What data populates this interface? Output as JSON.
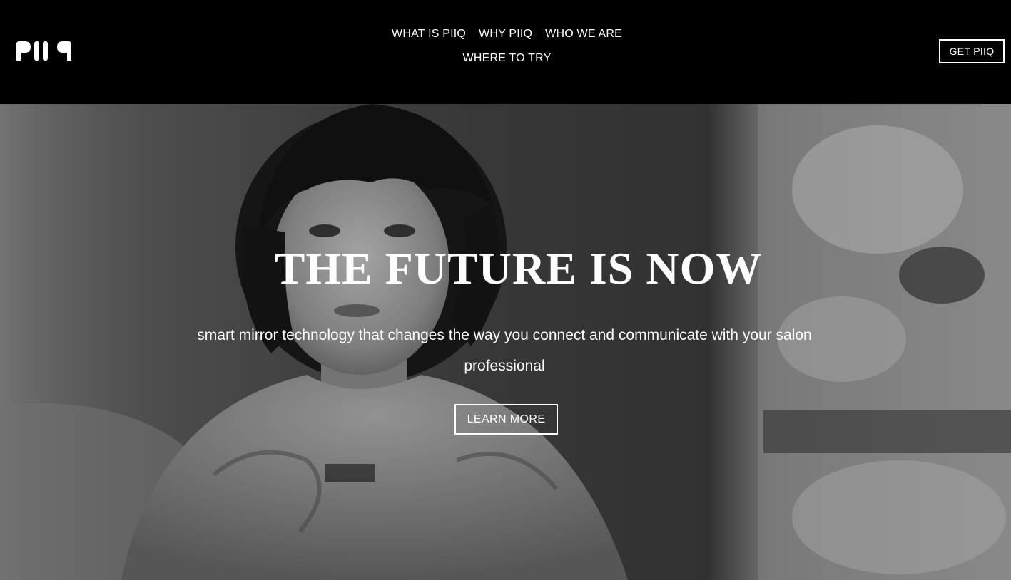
{
  "brand": {
    "logo_text": "PIIQ"
  },
  "nav": {
    "items": [
      {
        "label": "WHAT IS PIIQ"
      },
      {
        "label": "WHY PIIQ"
      },
      {
        "label": "WHO WE ARE"
      },
      {
        "label": "WHERE TO TRY"
      }
    ]
  },
  "header": {
    "cta_label": "GET PIIQ"
  },
  "hero": {
    "title": "THE FUTURE IS NOW",
    "subtitle": "smart mirror technology that changes the way you connect and communicate with your salon professional",
    "button_label": "LEARN MORE",
    "image": "black-and-white photo of a woman with a bob haircut looking into a salon mirror"
  },
  "colors": {
    "header_bg": "#000000",
    "text": "#ffffff"
  }
}
